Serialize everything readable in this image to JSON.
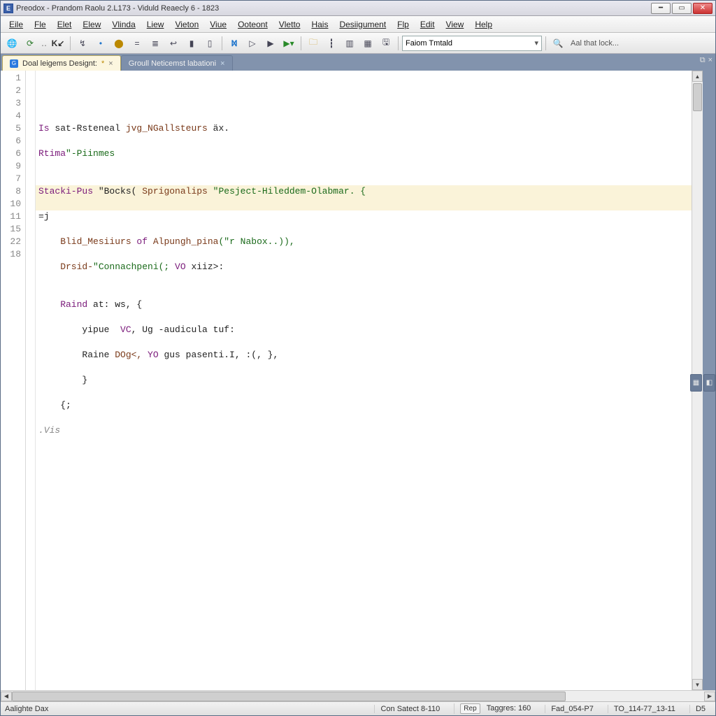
{
  "title": "Preodox - Prandom Raolu 2.L173 - Viduld Reaecly 6 - 1823",
  "menu": [
    "Eile",
    "Fle",
    "Elet",
    "Elew",
    "Vlinda",
    "Liew",
    "Vieton",
    "Viue",
    "Ooteont",
    "Vletto",
    "Hais",
    "Desiigument",
    "Flp",
    "Edit",
    "View",
    "Help"
  ],
  "toolbar_combo": "Faiom Tmtald",
  "toolbar_right_label": "Aal that lock...",
  "tabs": {
    "t0": {
      "label": "Doal leigems Designt:",
      "active": true
    },
    "t1": {
      "label": "Groull Neticemst labationi",
      "active": false
    }
  },
  "gutter": [
    "1",
    "2",
    "3",
    "4",
    "5",
    "6",
    "6",
    "9",
    "7",
    "8",
    "10",
    "11",
    "15",
    "22",
    "18"
  ],
  "code": {
    "l0": {
      "a": "Is",
      "b": " sat-Rsteneal ",
      "c": "jvg_NGallsteurs",
      "d": " äx."
    },
    "l1": {
      "a": "Rtima",
      "b": "\"-Piinmes"
    },
    "l2": "",
    "l3": {
      "a": "Stacki-Pus",
      "b": " \"Bocks( ",
      "c": "Sprigonalips",
      "d": " \"Pesject-Hileddem-Olabmar. {"
    },
    "l4": "=j",
    "l5": {
      "a": "    Blid_Mesiiurs",
      "b": " of ",
      "c": "Alpungh_pina",
      "d": "(\"r Nabox..)),"
    },
    "l6": {
      "a": "    Drsid-",
      "b": "\"Connachpeni(; ",
      "c": "VO",
      "d": " xiiz>:"
    },
    "l7": "",
    "l8": {
      "a": "    Raind",
      "b": " at: ws, {"
    },
    "l9": {
      "a": "        yipue  ",
      "b": "VC",
      "c": ", Ug -audicula tuf:"
    },
    "l10": {
      "a": "        Raine ",
      "b": "DOg<, ",
      "c": "YO",
      "d": " gus pasenti.I, :(, },"
    },
    "l11": "        }",
    "l12": "    {;",
    "l13": ".Vis",
    "l14": ""
  },
  "status": {
    "left": "Aalighte Dax",
    "mid": "Con Satect 8-110",
    "btn": "Rep",
    "tag": "Taggres: 160",
    "f1": "Fad_054-P7",
    "f2": "TO_114-77_13-11",
    "f3": "D5"
  }
}
